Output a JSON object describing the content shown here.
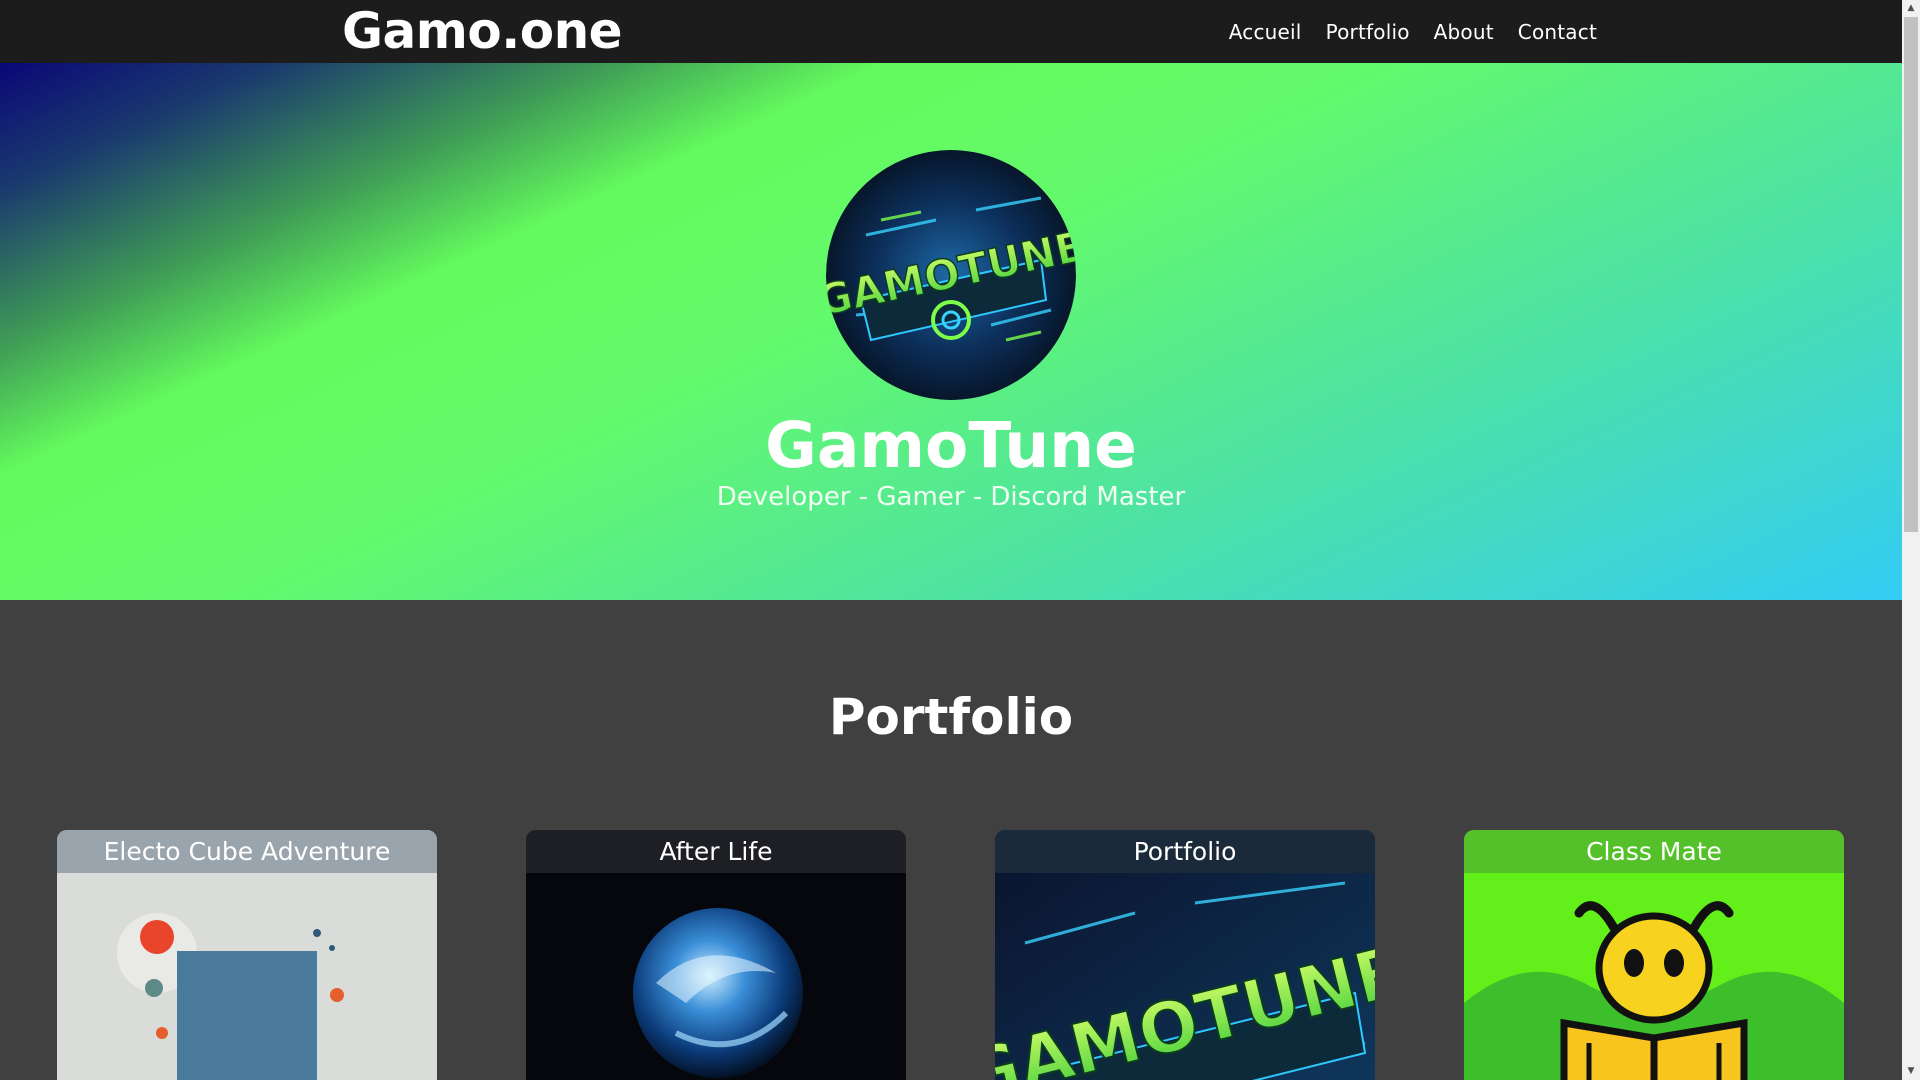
{
  "nav": {
    "brand": "Gamo.one",
    "links": [
      "Accueil",
      "Portfolio",
      "About",
      "Contact"
    ]
  },
  "hero": {
    "logo_text": "GAMOTUNE",
    "title": "GamoTune",
    "subtitle": "Developer - Gamer - Discord Master"
  },
  "portfolio": {
    "title": "Portfolio",
    "cards": [
      {
        "title": "Electo Cube Adventure",
        "header_color": "#9aa4ac"
      },
      {
        "title": "After Life",
        "header_color": "#1e1f24"
      },
      {
        "title": "Portfolio",
        "header_color": "#1b2a3a"
      },
      {
        "title": "Class Mate",
        "header_color": "#55c12a"
      }
    ]
  },
  "colors": {
    "navbar": "#1c1c1c",
    "page_background": "#404040",
    "hero_gradient": [
      "#0a0777",
      "#63fa5d",
      "#33ccf4"
    ]
  }
}
